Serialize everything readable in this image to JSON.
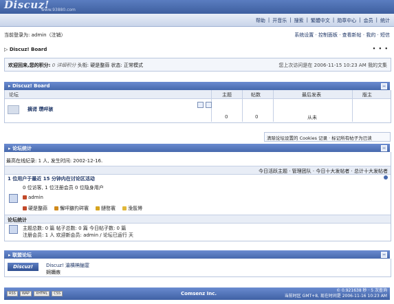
{
  "header": {
    "logo_text": "Discuz!",
    "logo_sub": "www.93880.com"
  },
  "topnav": {
    "items": [
      "帮助",
      "开音乐",
      "搜索",
      "繁體中文",
      "勋章中心",
      "会员",
      "统计"
    ]
  },
  "userbar": {
    "left": "当前登录为: admin（注销）",
    "right": "系统设置 · 控制面板 · 查看新帖 · 我的 · 短信"
  },
  "breadcrumb": {
    "title": "Discuz! Board",
    "dots": "• • •"
  },
  "welcome": {
    "left_prefix": "欢迎回来,您的积分:",
    "left_value": "0 详细积分",
    "left_rest": "头衔: 硬是整蒜  状态: 正常模式",
    "right": "您上次访问是在 2006-11-15 10:23 AM  我的文集"
  },
  "forum_box": {
    "title": "Discuz! Board",
    "toggle": "−",
    "col_forum": "论坛",
    "col_topics": "主题",
    "col_posts": "帖数",
    "col_last": "最后发表",
    "col_mod": "版主",
    "row": {
      "name": "摘谔  瓒呯骇",
      "topics": "0",
      "posts": "0",
      "last": "从未",
      "mod": ""
    }
  },
  "action_bar": "清除论坛设置的 Cookies 记录 · 标记所有帖子为已读",
  "stats_box": {
    "title": "论坛统计",
    "record": "最高在线纪录: 1 人, 发生时间: 2002-12-16.",
    "links": "今日活跃主题 · 管理团队 · 今日十大发帖者 · 总计十大发帖者",
    "online_title": "1 位用户于最近 15 分钟内在讨论区活动",
    "online_detail": "0 位访客, 1 位注册会员 0 位隐身用户",
    "online_user": "admin",
    "legend": [
      "硬是整蒜",
      "懈呯鏃犳硶寰",
      "鏈嶅寰",
      "浼氬憳"
    ],
    "stats_title": "论坛统计",
    "stats_line1": "主题总数: 0 篇  帖子总数: 0 篇  今日帖子数: 0 篇",
    "stats_line2": "注册会员: 1 人  欢迎新会员: admin / 论坛已运行 天"
  },
  "union_box": {
    "title": "联盟论坛",
    "logo": "Discuz!",
    "name": "Discuz! 瀹樻柟鏀寔",
    "desc": "娴嬭瘯"
  },
  "footer": {
    "badges": [
      "RSS",
      "WAP",
      "XHTML",
      "CSS"
    ],
    "center": "Comsenz Inc.",
    "right_line1": "© 0.921638 秒 · 5 次查询",
    "right_line2": "当前时区 GMT+8, 现在时间是 2006-11-16 10:23 AM"
  },
  "colors": {
    "accent": "#4669ad",
    "header_bg": "#5a7dc0"
  }
}
